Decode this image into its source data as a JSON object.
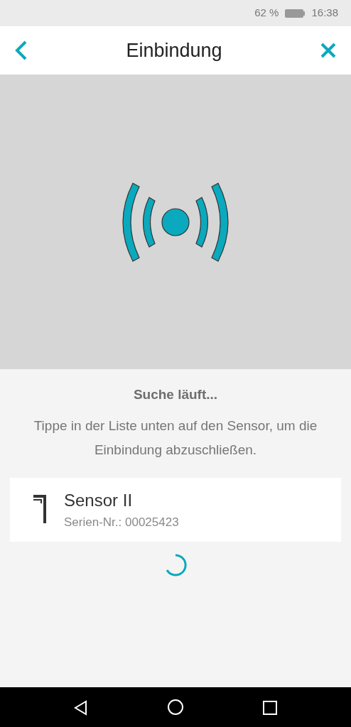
{
  "status_bar": {
    "battery": "62 %",
    "time": "16:38"
  },
  "header": {
    "title": "Einbindung"
  },
  "status": {
    "title": "Suche läuft...",
    "message": "Tippe in der Liste unten auf den Sensor, um die Einbindung abzuschließen."
  },
  "devices": [
    {
      "name": "Sensor II",
      "serial": "Serien-Nr.: 00025423"
    }
  ]
}
